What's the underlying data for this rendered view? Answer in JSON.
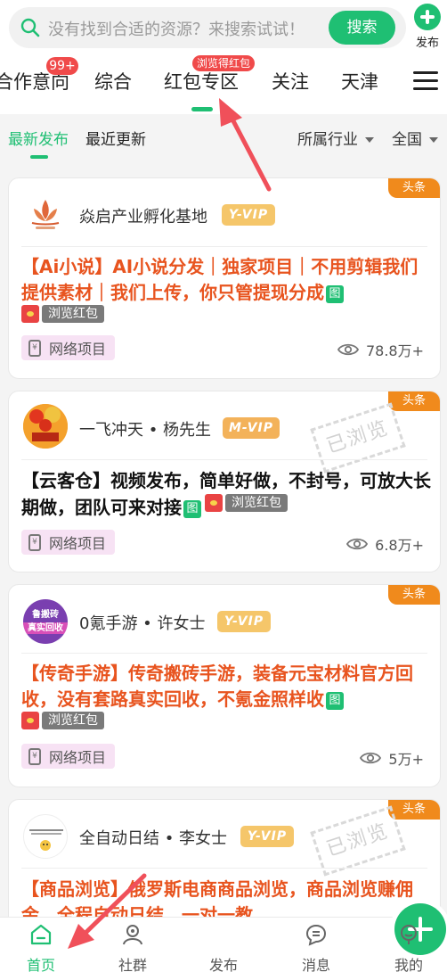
{
  "search": {
    "placeholder": "没有找到合适的资源？来搜索试试！",
    "button_label": "搜索",
    "publish_label": "发布"
  },
  "categories": {
    "items": [
      {
        "label": "合作意向",
        "badge": "99+"
      },
      {
        "label": "综合"
      },
      {
        "label": "红包专区",
        "badge": "浏览得红包",
        "active": true
      },
      {
        "label": "关注"
      },
      {
        "label": "天津"
      }
    ]
  },
  "filters": {
    "tabs": [
      {
        "label": "最新发布",
        "active": true
      },
      {
        "label": "最近更新"
      }
    ],
    "industry": "所属行业",
    "region": "全国"
  },
  "posts": [
    {
      "corner": "头条",
      "author": "焱启产业孵化基地",
      "vip": "Y-VIP",
      "title": "【Ai小说】AI小说分发｜独家项目｜不用剪辑我们提供素材｜我们上传，你只管提现分成",
      "img_tag": "图",
      "redpacket": "浏览红包",
      "category": "网络项目",
      "views": "78.8万+"
    },
    {
      "corner": "头条",
      "author": "一飞冲天 • 杨先生",
      "vip": "M-VIP",
      "title": "【云客仓】视频发布，简单好做，不封号，可放大长期做，团队可来对接",
      "img_tag": "图",
      "redpacket": "浏览红包",
      "category": "网络项目",
      "views": "6.8万+",
      "stamp": "已浏览"
    },
    {
      "corner": "头条",
      "author": "0氪手游 • 许女士",
      "vip": "Y-VIP",
      "avatar_text": [
        "鲁搬砖",
        "真实回收"
      ],
      "title": "【传奇手游】传奇搬砖手游，装备元宝材料官方回收，没有套路真实回收，不氪金照样收",
      "img_tag": "图",
      "redpacket": "浏览红包",
      "category": "网络项目",
      "views": "5万+"
    },
    {
      "corner": "头条",
      "author": "全自动日结 • 李女士",
      "vip": "Y-VIP",
      "title": "【商品浏览】俄罗斯电商商品浏览，商品浏览赚佣金，全程自动日结，一对一教",
      "stamp": "已浏览"
    }
  ],
  "bottom_nav": [
    {
      "label": "首页",
      "icon": "home-icon",
      "active": true
    },
    {
      "label": "社群",
      "icon": "community-icon"
    },
    {
      "label": "发布",
      "icon": "plus-icon"
    },
    {
      "label": "消息",
      "icon": "message-icon"
    },
    {
      "label": "我的",
      "icon": "profile-icon"
    }
  ],
  "colors": {
    "accent": "#1fbf73",
    "title_orange": "#e8541f",
    "corner_tag": "#f08a1c",
    "badge_red": "#f04a4a",
    "annotation_arrow": "#f0505a"
  }
}
